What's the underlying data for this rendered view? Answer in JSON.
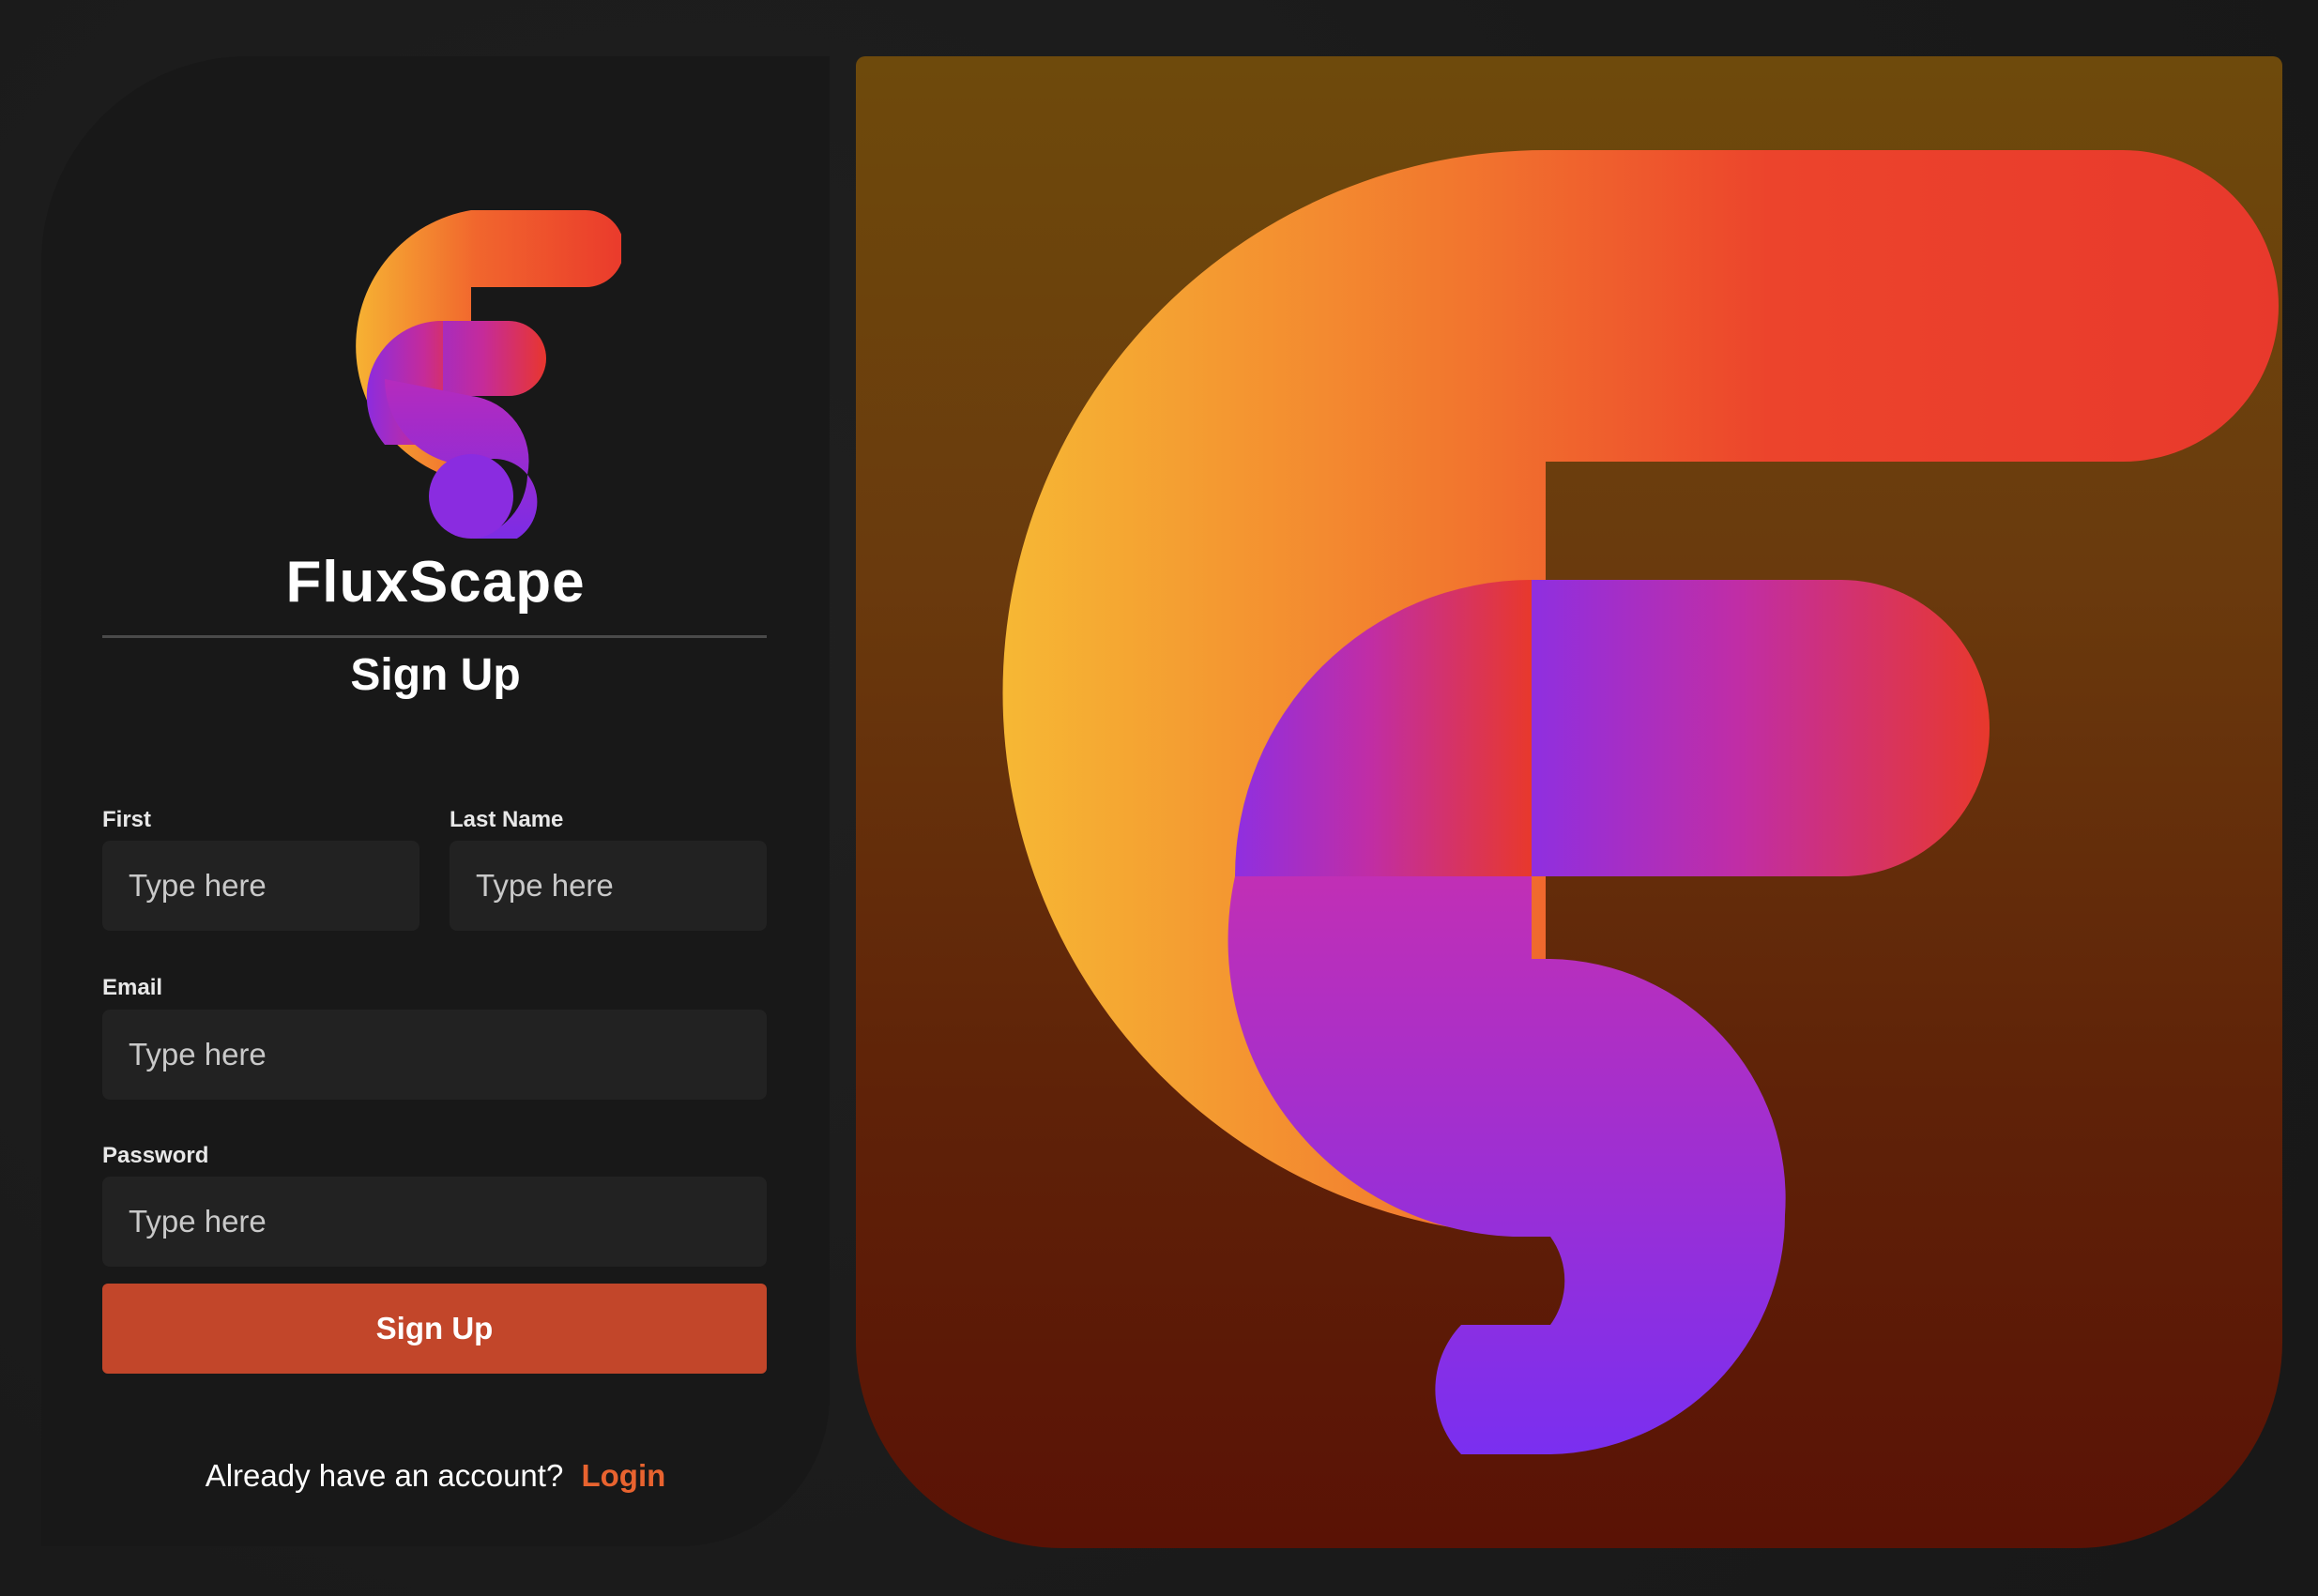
{
  "brand": {
    "name": "FluxScape",
    "logo_icon": "fluxscape-logo-icon"
  },
  "form": {
    "title": "Sign Up",
    "fields": {
      "first": {
        "label": "First",
        "placeholder": "Type here"
      },
      "last": {
        "label": "Last Name",
        "placeholder": "Type here"
      },
      "email": {
        "label": "Email",
        "placeholder": "Type here"
      },
      "password": {
        "label": "Password",
        "placeholder": "Type here"
      }
    },
    "submit_label": "Sign Up",
    "footer_text": "Already have an account?",
    "login_label": "Login"
  },
  "colors": {
    "accent": "#c2462a",
    "link": "#e8632f",
    "background": "#181818"
  }
}
